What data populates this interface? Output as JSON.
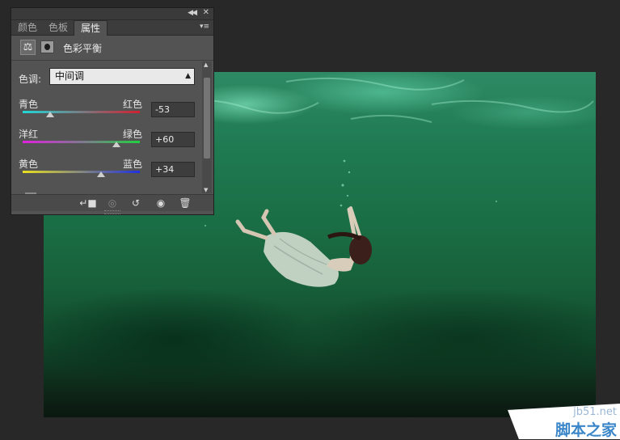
{
  "panel": {
    "tabs": [
      "颜色",
      "色板",
      "属性"
    ],
    "active_tab": 2,
    "title": "色彩平衡",
    "adjustment_icon": "balance-scale-icon",
    "tone": {
      "label": "色调:",
      "selected": "中间调"
    },
    "sliders": [
      {
        "left_label": "青色",
        "right_label": "红色",
        "value": "-53",
        "gradient": [
          "#20d8d8",
          "#d02030"
        ],
        "position": -53
      },
      {
        "left_label": "洋红",
        "right_label": "绿色",
        "value": "+60",
        "gradient": [
          "#e020e0",
          "#20d040"
        ],
        "position": 60
      },
      {
        "left_label": "黄色",
        "right_label": "蓝色",
        "value": "+34",
        "gradient": [
          "#e8e020",
          "#2030e0"
        ],
        "position": 34
      }
    ],
    "bottom_icons": [
      "clip-to-layer-icon",
      "view-previous-icon",
      "reset-icon",
      "visibility-eye-icon",
      "trash-icon"
    ]
  },
  "watermark": {
    "site": "jb51.net",
    "name": "脚本之家"
  }
}
